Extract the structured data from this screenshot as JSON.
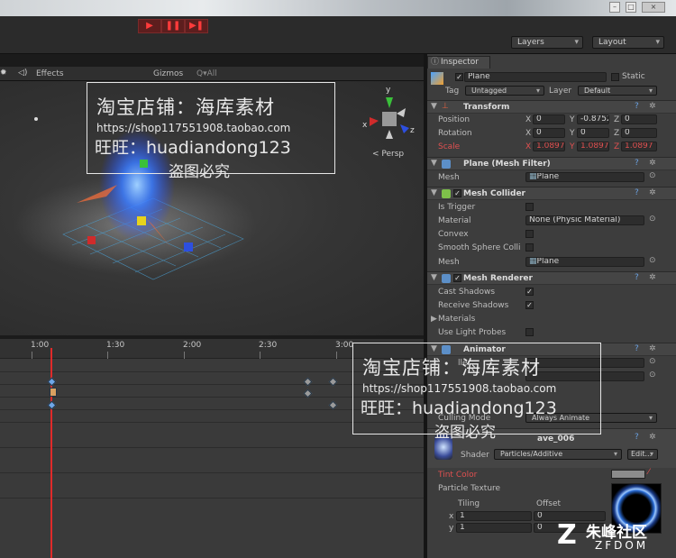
{
  "toolbar": {
    "layers": "Layers",
    "layout": "Layout",
    "play": "▶",
    "pause": "❚❚",
    "step": "▶❚"
  },
  "scene": {
    "effects": "Effects",
    "gizmos": "Gizmos",
    "search": "Q▾All",
    "persp": "< Persp",
    "axes": {
      "y": "y",
      "x": "x",
      "z": "z"
    }
  },
  "timeline": {
    "ticks": [
      "1:00",
      "1:30",
      "2:00",
      "2:30",
      "3:00"
    ]
  },
  "inspector": {
    "tab": "Inspector",
    "object_name": "Plane",
    "static": "Static",
    "tag_label": "Tag",
    "tag": "Untagged",
    "layer_label": "Layer",
    "layer": "Default",
    "transform": {
      "title": "Transform",
      "position": "Position",
      "rotation": "Rotation",
      "scale": "Scale",
      "pos": [
        "0",
        "-0.8752",
        "0"
      ],
      "rot": [
        "0",
        "0",
        "0"
      ],
      "scl": [
        "1.0897",
        "1.0897",
        "1.0897"
      ],
      "axes": [
        "X",
        "Y",
        "Z"
      ]
    },
    "mesh_filter": {
      "title": "Plane (Mesh Filter)",
      "mesh_label": "Mesh",
      "mesh": "Plane"
    },
    "mesh_collider": {
      "title": "Mesh Collider",
      "is_trigger": "Is Trigger",
      "material": "Material",
      "material_value": "None (Physic Material)",
      "convex": "Convex",
      "smooth": "Smooth Sphere Colli",
      "mesh": "Mesh",
      "mesh_value": "Plane"
    },
    "mesh_renderer": {
      "title": "Mesh Renderer",
      "cast": "Cast Shadows",
      "receive": "Receive Shadows",
      "materials": "Materials",
      "probes": "Use Light Probes"
    },
    "animator": {
      "title": "Animator",
      "controller": "ller",
      "culling": "Culling Mode",
      "culling_value": "Always Animate"
    },
    "material": {
      "name": "ave_006",
      "shader": "Shader",
      "shader_value": "Particles/Additive",
      "edit": "Edit...",
      "tint": "Tint Color",
      "texture": "Particle Texture",
      "tiling": "Tiling",
      "offset": "Offset",
      "x": "x",
      "y": "y",
      "tx": "1",
      "ty": "1",
      "ox": "0",
      "oy": "0"
    }
  },
  "watermark": {
    "line1": "淘宝店铺：海库素材",
    "line2": "https://shop117551908.taobao.com",
    "line3": "旺旺：huadiandong123",
    "line4": "盗图必究"
  },
  "logo": {
    "text": "朱峰社区",
    "sub": "ZFDOM"
  },
  "colors": {
    "accent_red": "#e05050",
    "key_blue": "#6fa7e8",
    "play_red": "#ff3b3b"
  }
}
